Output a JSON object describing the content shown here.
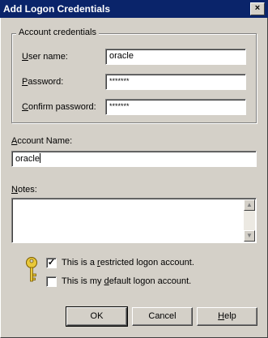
{
  "window": {
    "title": "Add Logon Credentials",
    "close_glyph": "×"
  },
  "account_credentials": {
    "legend": "Account credentials",
    "user_name": {
      "label_u": "U",
      "label_rest": "ser name:",
      "value": "oracle"
    },
    "password": {
      "label_u": "P",
      "label_rest": "assword:",
      "value": "*******"
    },
    "confirm_password": {
      "label_u": "C",
      "label_rest": "onfirm password:",
      "value": "*******"
    }
  },
  "account_name": {
    "label_u": "A",
    "label_rest": "ccount Name:",
    "value": "oracle"
  },
  "notes": {
    "label_u": "N",
    "label_rest": "otes:",
    "value": ""
  },
  "options": {
    "restricted": {
      "prefix": "This is a ",
      "underlined": "r",
      "suffix": "estricted logon account.",
      "checked": true,
      "mark": "✓"
    },
    "default": {
      "prefix": "This is my ",
      "underlined": "d",
      "suffix": "efault logon account.",
      "checked": false
    }
  },
  "buttons": {
    "ok": "OK",
    "cancel": "Cancel",
    "help_u": "H",
    "help_rest": "elp"
  },
  "key_icon": "key-icon"
}
